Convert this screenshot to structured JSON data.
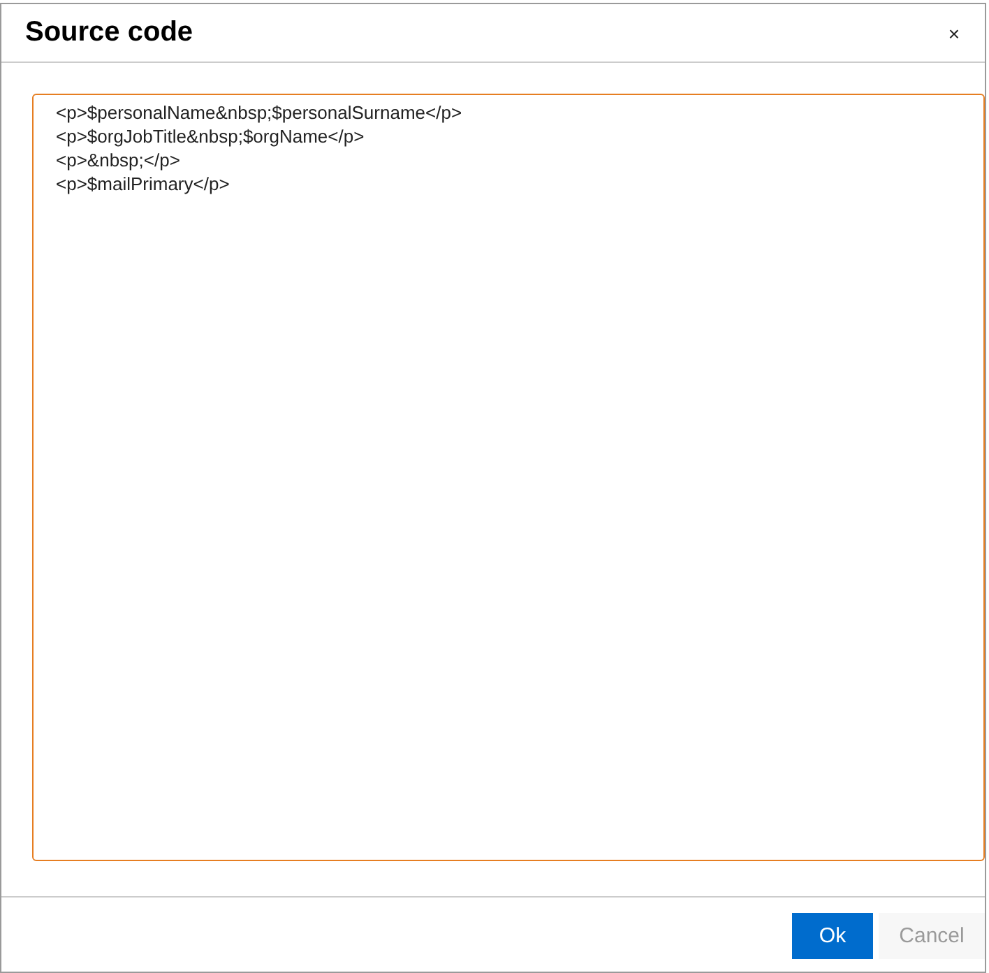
{
  "dialog": {
    "title": "Source code",
    "close": "×"
  },
  "source": {
    "lines": [
      "<p>$personalName&nbsp;$personalSurname</p>",
      "<p>$orgJobTitle&nbsp;$orgName</p>",
      "<p>&nbsp;</p>",
      "<p>$mailPrimary</p>"
    ]
  },
  "buttons": [
    {
      "label": "Ok",
      "kind": "primary"
    },
    {
      "label": "Cancel",
      "kind": "secondary"
    }
  ]
}
